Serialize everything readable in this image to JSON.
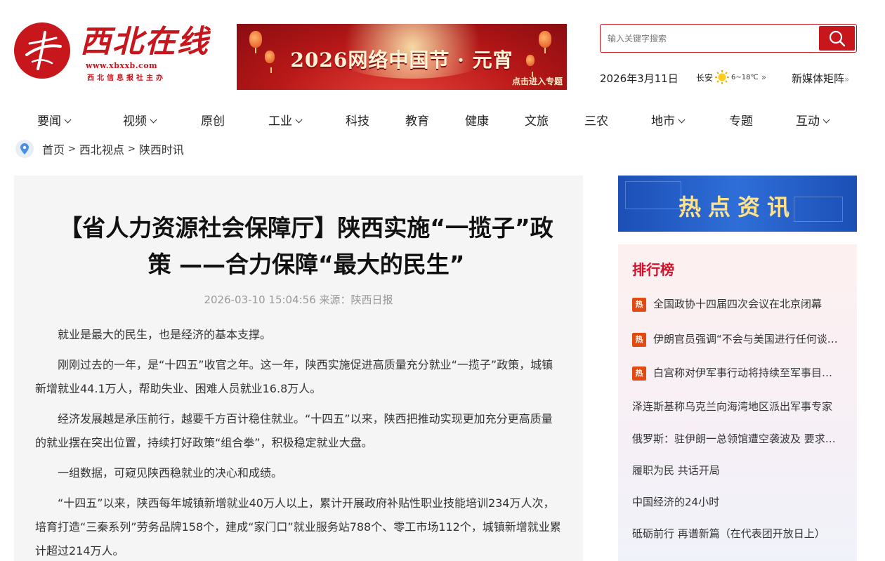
{
  "site": {
    "logo_name": "西北在线",
    "logo_url": "www.xbxxb.com",
    "logo_org": "西北信息报社主办"
  },
  "banner": {
    "headline": "2026网络中国节 · 元宵",
    "cta": "点击进入专题"
  },
  "search": {
    "placeholder": "输入关键字搜索"
  },
  "header": {
    "date": "2026年3月11日",
    "city": "长安",
    "temperature": "6~18℃",
    "weather_more": "»",
    "media_matrix": "新媒体矩阵",
    "media_matrix_chev": "»"
  },
  "nav": [
    {
      "label": "要闻",
      "dropdown": true
    },
    {
      "label": "视频",
      "dropdown": true
    },
    {
      "label": "原创",
      "dropdown": false
    },
    {
      "label": "工业",
      "dropdown": true
    },
    {
      "label": "科技",
      "dropdown": false
    },
    {
      "label": "教育",
      "dropdown": false
    },
    {
      "label": "健康",
      "dropdown": false
    },
    {
      "label": "文旅",
      "dropdown": false
    },
    {
      "label": "三农",
      "dropdown": false
    },
    {
      "label": "地市",
      "dropdown": true
    },
    {
      "label": "专题",
      "dropdown": false
    },
    {
      "label": "互动",
      "dropdown": true
    }
  ],
  "breadcrumb": [
    "首页",
    "西北视点",
    "陕西时讯"
  ],
  "breadcrumb_sep": ">",
  "article": {
    "title": "【省人力资源社会保障厅】陕西实施“一揽子”政策 ——合力保障“最大的民生”",
    "meta": "2026-03-10 15:04:56 来源：陕西日报",
    "paragraphs": [
      "就业是最大的民生，也是经济的基本支撑。",
      "刚刚过去的一年，是“十四五”收官之年。这一年，陕西实施促进高质量充分就业“一揽子”政策，城镇新增就业44.1万人，帮助失业、困难人员就业16.8万人。",
      "经济发展越是承压前行，越要千方百计稳住就业。“十四五”以来，陕西把推动实现更加充分更高质量的就业摆在突出位置，持续打好政策“组合拳”，积极稳定就业大盘。",
      "一组数据，可窥见陕西稳就业的决心和成绩。",
      "“十四五”以来，陕西每年城镇新增就业40万人以上，累计开展政府补贴性职业技能培训234万人次，培育打造“三秦系列”劳务品牌158个，建成“家门口”就业服务站788个、零工市场112个，城镇新增就业累计超过214万人。"
    ]
  },
  "sidebar": {
    "hot_banner": "热点资讯",
    "rank_title": "排行榜",
    "hot_badge": "热",
    "rank_items": [
      {
        "text": "全国政协十四届四次会议在北京闭幕",
        "hot": true
      },
      {
        "text": "伊朗官员强调“不会与美国进行任何谈判”",
        "hot": true
      },
      {
        "text": "白宫称对伊军事行动将持续至军事目标达成",
        "hot": true
      },
      {
        "text": "泽连斯基称乌克兰向海湾地区派出军事专家",
        "hot": false
      },
      {
        "text": "俄罗斯：驻伊朗一总领馆遭空袭波及 要求各方克制",
        "hot": false
      },
      {
        "text": "履职为民 共话开局",
        "hot": false
      },
      {
        "text": "中国经济的24小时",
        "hot": false
      },
      {
        "text": "砥砺前行 再谱新篇（在代表团开放日上）",
        "hot": false
      }
    ]
  },
  "colors": {
    "brand_red": "#c8161d",
    "hot_orange": "#e14a12",
    "rank_title_red": "#d0122a",
    "hot_banner_blue": "#1b4fb6"
  }
}
